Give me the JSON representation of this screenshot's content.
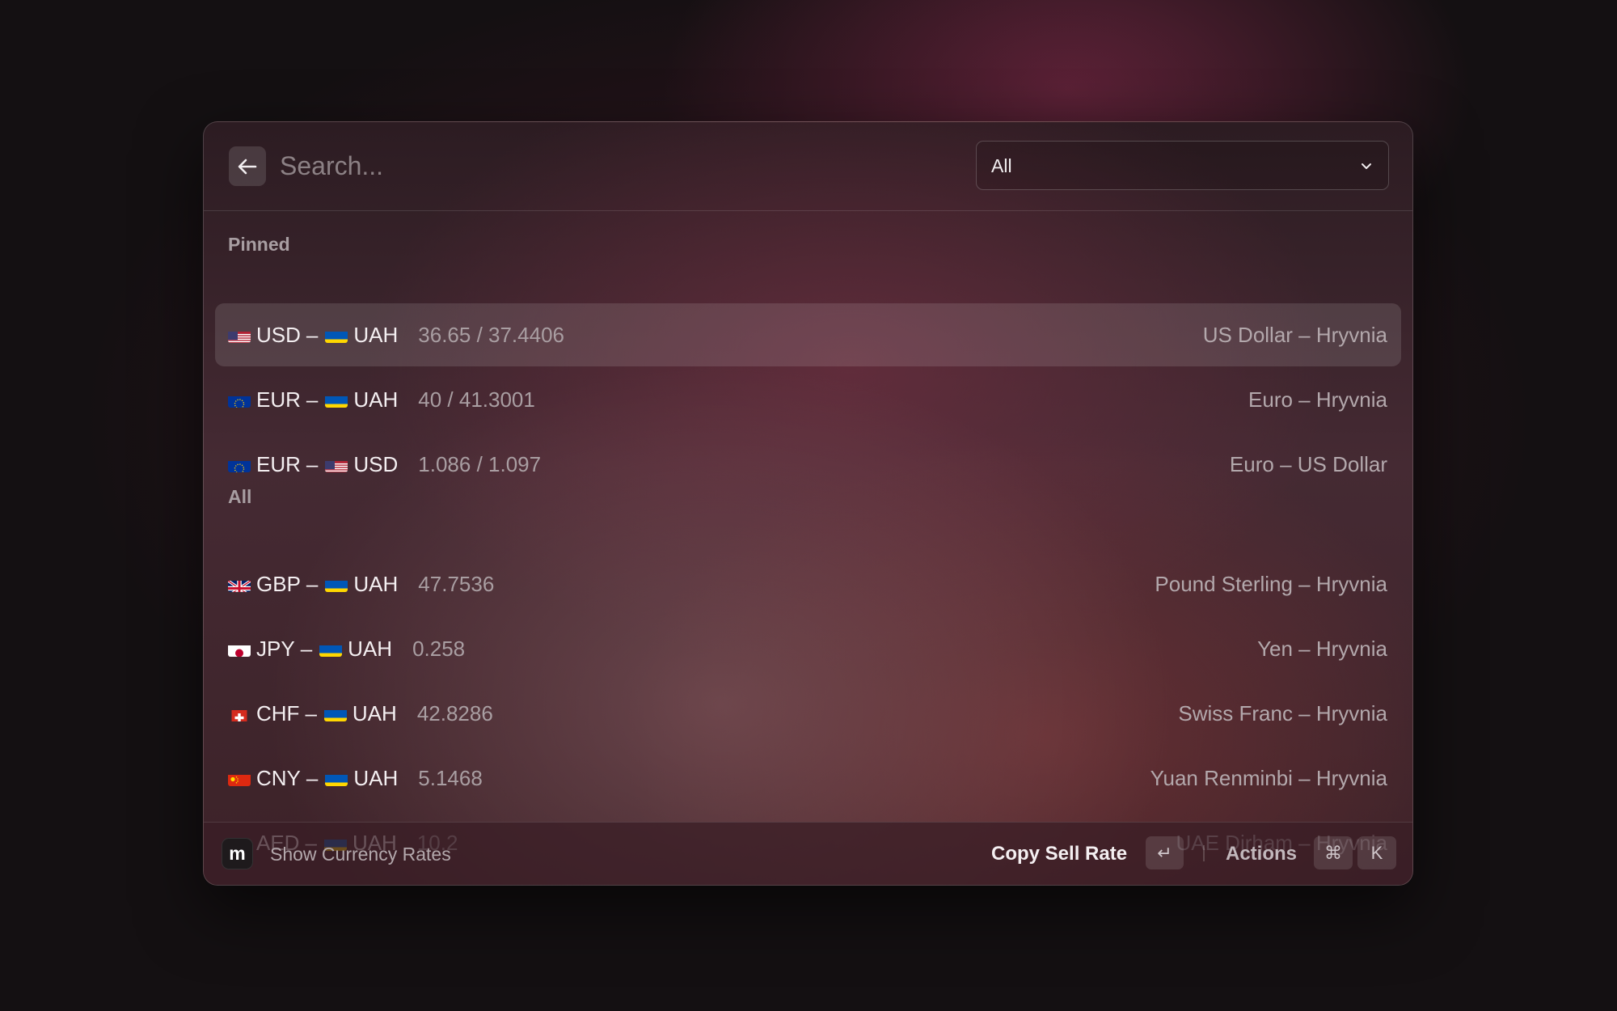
{
  "search": {
    "placeholder": "Search..."
  },
  "filter": {
    "selected": "All"
  },
  "sections": {
    "pinned": {
      "title": "Pinned"
    },
    "all": {
      "title": "All"
    }
  },
  "pinned": [
    {
      "from_flag": "us-flag",
      "from": "USD",
      "dash": "–",
      "to_flag": "ua-flag",
      "to": "UAH",
      "rate": "36.65 / 37.4406",
      "name": "US Dollar – Hryvnia"
    },
    {
      "from_flag": "eu-flag",
      "from": "EUR",
      "dash": "–",
      "to_flag": "ua-flag",
      "to": "UAH",
      "rate": "40 / 41.3001",
      "name": "Euro – Hryvnia"
    },
    {
      "from_flag": "eu-flag",
      "from": "EUR",
      "dash": "–",
      "to_flag": "us-flag",
      "to": "USD",
      "rate": "1.086 / 1.097",
      "name": "Euro – US Dollar"
    }
  ],
  "all": [
    {
      "from_flag": "gb-flag",
      "from": "GBP",
      "dash": "–",
      "to_flag": "ua-flag",
      "to": "UAH",
      "rate": "47.7536",
      "name": "Pound Sterling – Hryvnia"
    },
    {
      "from_flag": "jp-flag",
      "from": "JPY",
      "dash": "–",
      "to_flag": "ua-flag",
      "to": "UAH",
      "rate": "0.258",
      "name": "Yen – Hryvnia"
    },
    {
      "from_flag": "ch-flag",
      "from": "CHF",
      "dash": "–",
      "to_flag": "ua-flag",
      "to": "UAH",
      "rate": "42.8286",
      "name": "Swiss Franc – Hryvnia"
    },
    {
      "from_flag": "cn-flag",
      "from": "CNY",
      "dash": "–",
      "to_flag": "ua-flag",
      "to": "UAH",
      "rate": "5.1468",
      "name": "Yuan Renminbi – Hryvnia"
    },
    {
      "from_flag": "ae-flag",
      "from": "AED",
      "dash": "–",
      "to_flag": "ua-flag",
      "to": "UAH",
      "rate": "10.2",
      "name": "UAE Dirham – Hryvnia"
    }
  ],
  "footer": {
    "app_icon": "m",
    "app_title": "Show Currency Rates",
    "primary_action": "Copy Sell Rate",
    "primary_key": "↵",
    "actions_label": "Actions",
    "actions_keys": [
      "⌘",
      "K"
    ]
  },
  "colors": {
    "background": "#141012",
    "window": "#3c2228",
    "text_primary": "#f4eff1",
    "text_secondary": "#a99ea2"
  }
}
